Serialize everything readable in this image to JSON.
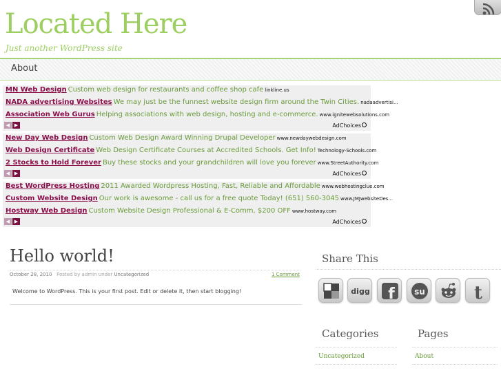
{
  "site": {
    "title": "Located Here",
    "tagline": "Just another WordPress site"
  },
  "nav": {
    "items": [
      {
        "label": "About"
      }
    ]
  },
  "ads": {
    "adchoices_label": "AdChoices",
    "blocks": [
      {
        "rows": [
          {
            "title": "MN Web Design",
            "desc": "Custom web design for restaurants and coffee shop cafe",
            "url": "linkline.us"
          },
          {
            "title": "NADA advertising Websites",
            "desc": "We may just be the funnest website design firm around the Twin Cities.",
            "url": "nadaadvertisi..."
          },
          {
            "title": "Association Web Gurus",
            "desc": "Helping associations with web design, hosting and e-commerce.",
            "url": "www.ignitewebsolutions.com"
          }
        ]
      },
      {
        "rows": [
          {
            "title": "New Day Web Design",
            "desc": "Custom Web Design Award Winning Drupal Developer",
            "url": "www.newdaywebdesign.com"
          },
          {
            "title": "Web Design Certificate",
            "desc": "Web Design Certificate Courses at Accredited Schools. Get Info!",
            "url": "Technology-Schools.com"
          },
          {
            "title": "2 Stocks to Hold Forever",
            "desc": "Buy these stocks and your grandchildren will love you forever",
            "url": "www.StreetAuthority.com"
          }
        ]
      },
      {
        "rows": [
          {
            "title": "Best WordPress Hosting",
            "desc": "2011 Awarded Wordpress Hosting, Fast, Reliable and Affordable",
            "url": "www.webhostingclue.com"
          },
          {
            "title": "Custom Website Design",
            "desc": "Our work is awesome - call us for a free quote Today! (651) 560-3045",
            "url": "www.JMJwebsiteDes..."
          },
          {
            "title": "Hostway Web Design",
            "desc": "Custom Website Design Professional & E-Comm, $200 OFF",
            "url": "www.hostway.com"
          }
        ]
      }
    ]
  },
  "post": {
    "title": "Hello world!",
    "date": "October 28, 2010",
    "by_label": "Posted by admin under",
    "category": "Uncategorized",
    "comments": "1 Comment",
    "body": "Welcome to WordPress. This is your first post. Edit or delete it, then start blogging!"
  },
  "sidebar": {
    "share_title": "Share This",
    "share_icons": [
      "delicious-icon",
      "digg-icon",
      "facebook-icon",
      "stumbleupon-icon",
      "reddit-icon",
      "twitter-icon"
    ],
    "categories": {
      "title": "Categories",
      "items": [
        "Uncategorized"
      ]
    },
    "pages": {
      "title": "Pages",
      "items": [
        "About"
      ]
    }
  },
  "colors": {
    "accent": "#9ccf5f",
    "ad_title": "#8a0f4a",
    "ad_desc": "#6a9b3a"
  }
}
